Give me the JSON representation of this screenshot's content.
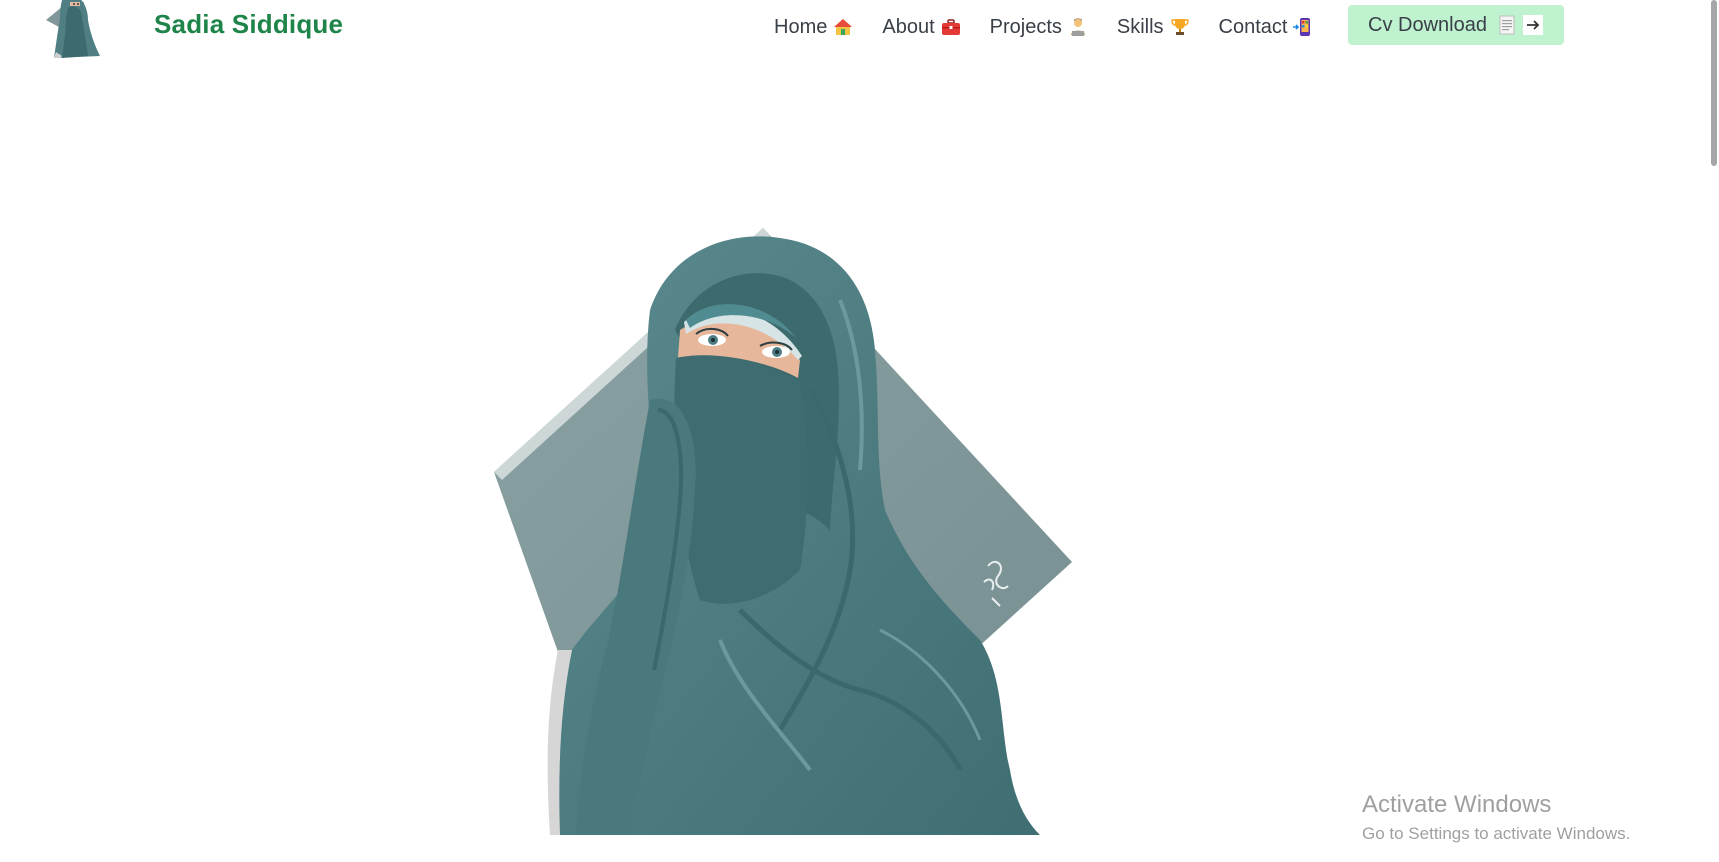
{
  "header": {
    "brand_name": "Sadia Siddique",
    "logo_icon": "avatar-logo-icon"
  },
  "nav": {
    "items": [
      {
        "label": "Home",
        "icon": "house-icon"
      },
      {
        "label": "About",
        "icon": "briefcase-icon"
      },
      {
        "label": "Projects",
        "icon": "technologist-icon"
      },
      {
        "label": "Skills",
        "icon": "trophy-icon"
      },
      {
        "label": "Contact",
        "icon": "phone-arrow-icon"
      }
    ],
    "cv_button": {
      "label": "Cv Download",
      "icons": [
        "document-icon",
        "arrow-right-icon"
      ]
    }
  },
  "hero": {
    "illustration": "niqab-woman-illustration"
  },
  "watermark": {
    "title": "Activate Windows",
    "subtitle": "Go to Settings to activate Windows."
  },
  "colors": {
    "brand_green": "#1e8449",
    "cv_button_bg": "#bff2cf",
    "nav_text": "#3a4048",
    "teal_dark": "#3c6a6d",
    "teal_mid": "#4f7f83",
    "diamond_gray": "#7f9799"
  }
}
